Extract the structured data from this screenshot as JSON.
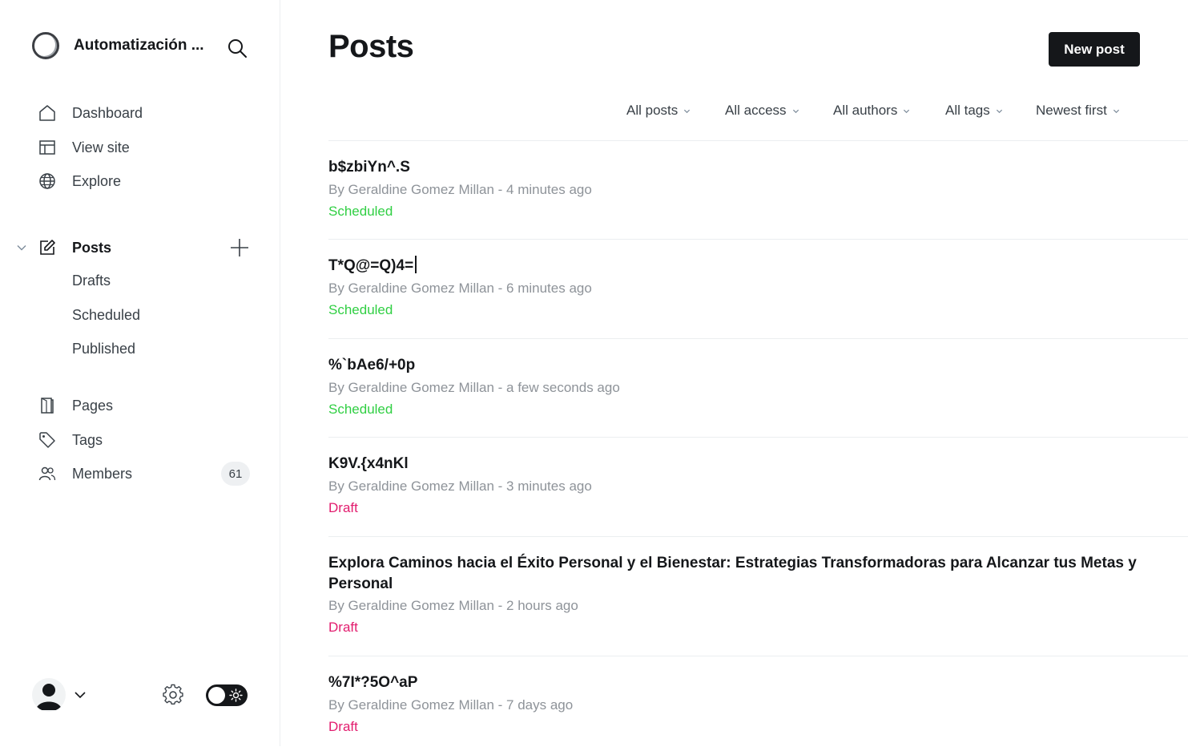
{
  "sidebar": {
    "site_name": "Automatización ...",
    "nav": [
      {
        "label": "Dashboard",
        "icon": "home-icon"
      },
      {
        "label": "View site",
        "icon": "layout-icon"
      },
      {
        "label": "Explore",
        "icon": "globe-icon"
      }
    ],
    "posts": {
      "label": "Posts",
      "icon": "edit-icon",
      "sub_items": [
        "Drafts",
        "Scheduled",
        "Published"
      ]
    },
    "secondary_nav": [
      {
        "label": "Pages",
        "icon": "page-icon"
      },
      {
        "label": "Tags",
        "icon": "tag-icon"
      },
      {
        "label": "Members",
        "icon": "members-icon",
        "count": "61"
      }
    ]
  },
  "main": {
    "title": "Posts",
    "new_post_label": "New post",
    "filters": [
      "All posts",
      "All access",
      "All authors",
      "All tags",
      "Newest first"
    ],
    "posts": [
      {
        "title": "b$zbiYn^.S",
        "meta": "By Geraldine Gomez Millan - 4 minutes ago",
        "status": "Scheduled",
        "status_type": "scheduled"
      },
      {
        "title": "T*Q@=Q)4=",
        "meta": "By Geraldine Gomez Millan - 6 minutes ago",
        "status": "Scheduled",
        "status_type": "scheduled"
      },
      {
        "title": "%`bAe6/+0p",
        "meta": "By Geraldine Gomez Millan - a few seconds ago",
        "status": "Scheduled",
        "status_type": "scheduled"
      },
      {
        "title": "K9V.{x4nKl",
        "meta": "By Geraldine Gomez Millan - 3 minutes ago",
        "status": "Draft",
        "status_type": "draft"
      },
      {
        "title_line1": "Explora Caminos hacia el Éxito Personal y el Bienestar: Estrategias Transformadoras para Alcanzar tus Metas y",
        "title_line2": "Personal",
        "meta": "By Geraldine Gomez Millan - 2 hours ago",
        "status": "Draft",
        "status_type": "draft"
      },
      {
        "title": "%7I*?5O^aP",
        "meta": "By Geraldine Gomez Millan - 7 days ago",
        "status": "Draft",
        "status_type": "draft"
      }
    ]
  },
  "colors": {
    "scheduled": "#30cf43",
    "draft": "#e21c6e",
    "primary_button": "#15171a"
  }
}
